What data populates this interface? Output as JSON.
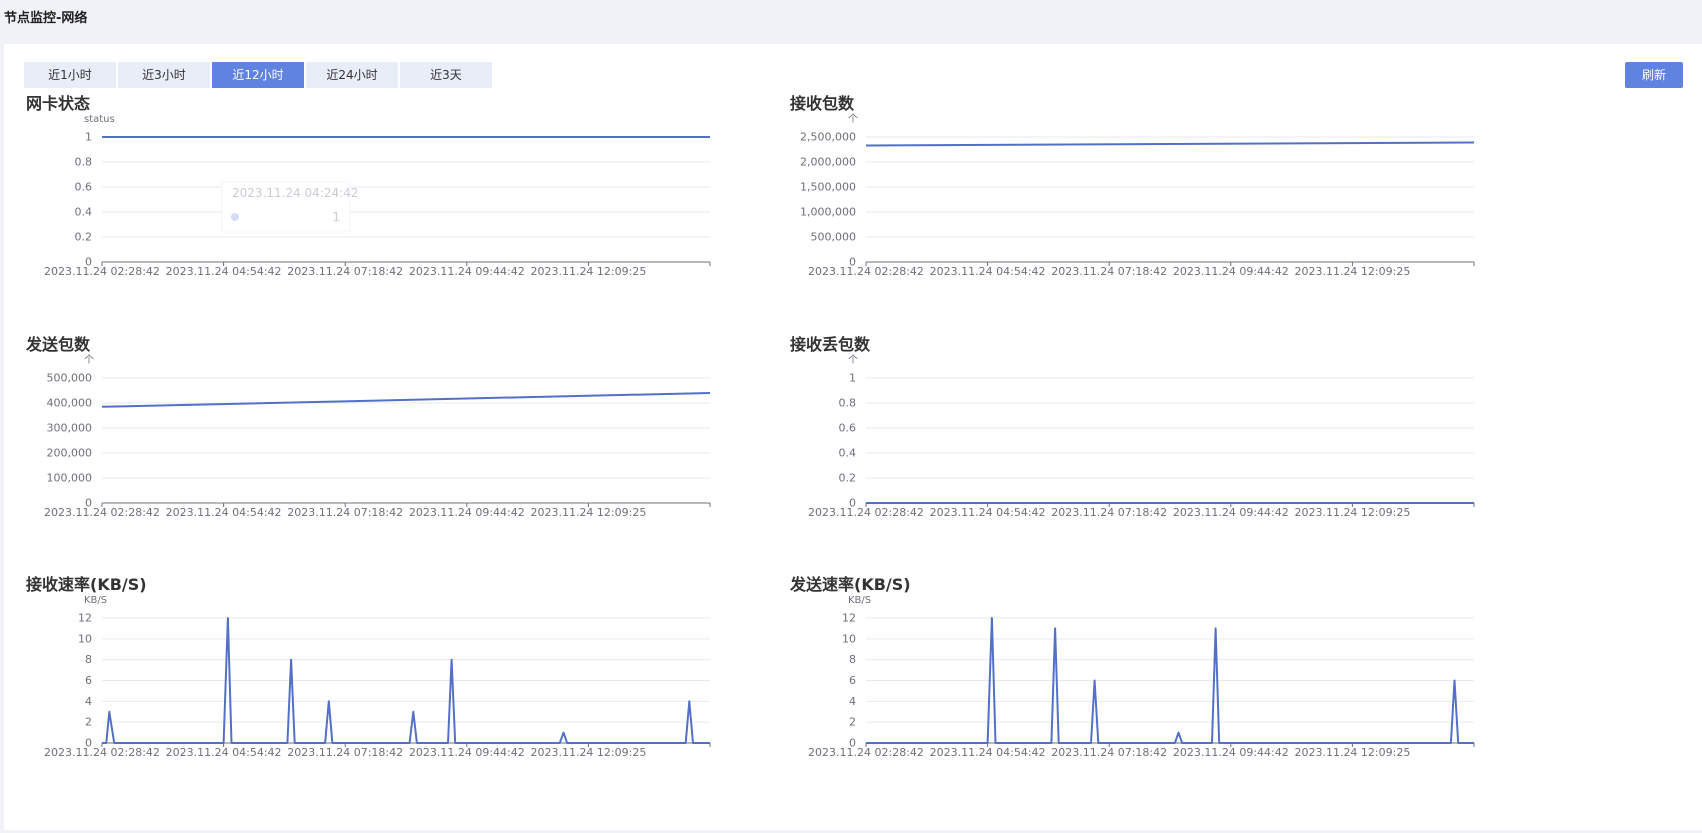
{
  "page": {
    "title": "节点监控-网络"
  },
  "toolbar": {
    "tabs": [
      {
        "label": "近1小时",
        "active": false
      },
      {
        "label": "近3小时",
        "active": false
      },
      {
        "label": "近12小时",
        "active": true
      },
      {
        "label": "近24小时",
        "active": false
      },
      {
        "label": "近3天",
        "active": false
      }
    ],
    "refresh_label": "刷新"
  },
  "colors": {
    "series": "#5470c6",
    "accent": "#6082e0",
    "grid": "#e6e9f0",
    "axis_text": "#6e7079",
    "tooltip_text": "#c9ccd3"
  },
  "chart_data": [
    {
      "id": "nic-status",
      "type": "line",
      "title": "网卡状态",
      "ylabel": "status",
      "ylim": [
        0,
        1
      ],
      "yticks": [
        0,
        0.2,
        0.4,
        0.6,
        0.8,
        1
      ],
      "xticks": [
        "2023.11.24 02:28:42",
        "2023.11.24 04:54:42",
        "2023.11.24 07:18:42",
        "2023.11.24 09:44:42",
        "2023.11.24 12:09:25"
      ],
      "x": [
        0,
        1
      ],
      "values": [
        1,
        1
      ],
      "grid": true,
      "tooltip": {
        "time": "2023.11.24 04:24:42",
        "value": "1"
      }
    },
    {
      "id": "rx-packets",
      "type": "line",
      "title": "接收包数",
      "ylabel": "个",
      "ylim": [
        0,
        2500000
      ],
      "yticks": [
        0,
        500000,
        1000000,
        1500000,
        2000000,
        2500000
      ],
      "xticks": [
        "2023.11.24 02:28:42",
        "2023.11.24 04:54:42",
        "2023.11.24 07:18:42",
        "2023.11.24 09:44:42",
        "2023.11.24 12:09:25"
      ],
      "x": [
        0,
        1
      ],
      "values": [
        2330000,
        2390000
      ],
      "grid": true
    },
    {
      "id": "tx-packets",
      "type": "line",
      "title": "发送包数",
      "ylabel": "个",
      "ylim": [
        0,
        500000
      ],
      "yticks": [
        0,
        100000,
        200000,
        300000,
        400000,
        500000
      ],
      "xticks": [
        "2023.11.24 02:28:42",
        "2023.11.24 04:54:42",
        "2023.11.24 07:18:42",
        "2023.11.24 09:44:42",
        "2023.11.24 12:09:25"
      ],
      "x": [
        0,
        1
      ],
      "values": [
        385000,
        440000
      ],
      "grid": true
    },
    {
      "id": "rx-dropped",
      "type": "line",
      "title": "接收丢包数",
      "ylabel": "个",
      "ylim": [
        0,
        1
      ],
      "yticks": [
        0,
        0.2,
        0.4,
        0.6,
        0.8,
        1
      ],
      "xticks": [
        "2023.11.24 02:28:42",
        "2023.11.24 04:54:42",
        "2023.11.24 07:18:42",
        "2023.11.24 09:44:42",
        "2023.11.24 12:09:25"
      ],
      "x": [
        0,
        1
      ],
      "values": [
        0,
        0
      ],
      "grid": true
    },
    {
      "id": "rx-rate",
      "type": "line",
      "title": "接收速率(KB/S)",
      "ylabel": "KB/S",
      "ylim": [
        0,
        12
      ],
      "yticks": [
        0,
        2,
        4,
        6,
        8,
        10,
        12
      ],
      "xticks": [
        "2023.11.24 02:28:42",
        "2023.11.24 04:54:42",
        "2023.11.24 07:18:42",
        "2023.11.24 09:44:42",
        "2023.11.24 12:09:25"
      ],
      "x": [
        0,
        0.007,
        0.012,
        0.02,
        0.2,
        0.207,
        0.213,
        0.305,
        0.311,
        0.317,
        0.367,
        0.373,
        0.379,
        0.506,
        0.512,
        0.518,
        0.569,
        0.575,
        0.581,
        0.753,
        0.759,
        0.765,
        0.96,
        0.966,
        0.972,
        1
      ],
      "values": [
        0,
        0,
        3,
        0,
        0,
        12,
        0,
        0,
        8,
        0,
        0,
        4,
        0,
        0,
        3,
        0,
        0,
        8,
        0,
        0,
        1,
        0,
        0,
        4,
        0,
        0
      ],
      "grid": true
    },
    {
      "id": "tx-rate",
      "type": "line",
      "title": "发送速率(KB/S)",
      "ylabel": "KB/S",
      "ylim": [
        0,
        12
      ],
      "yticks": [
        0,
        2,
        4,
        6,
        8,
        10,
        12
      ],
      "xticks": [
        "2023.11.24 02:28:42",
        "2023.11.24 04:54:42",
        "2023.11.24 07:18:42",
        "2023.11.24 09:44:42",
        "2023.11.24 12:09:25"
      ],
      "x": [
        0,
        0.2,
        0.207,
        0.213,
        0.305,
        0.311,
        0.317,
        0.37,
        0.376,
        0.382,
        0.508,
        0.514,
        0.52,
        0.569,
        0.575,
        0.581,
        0.962,
        0.968,
        0.974,
        1
      ],
      "values": [
        0,
        0,
        12,
        0,
        0,
        11,
        0,
        0,
        6,
        0,
        0,
        1,
        0,
        0,
        11,
        0,
        0,
        6,
        0,
        0
      ],
      "grid": true
    }
  ]
}
